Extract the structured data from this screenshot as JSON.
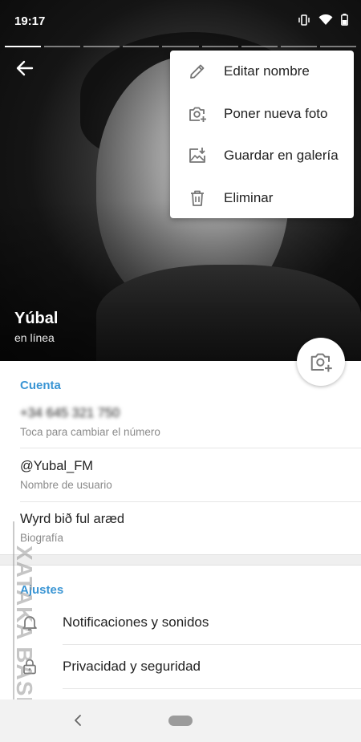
{
  "status_bar": {
    "time": "19:17"
  },
  "profile": {
    "name": "Yúbal",
    "status": "en línea"
  },
  "menu": {
    "items": [
      {
        "label": "Editar nombre",
        "icon": "pencil-icon"
      },
      {
        "label": "Poner nueva foto",
        "icon": "camera-add-icon"
      },
      {
        "label": "Guardar en galería",
        "icon": "save-image-icon"
      },
      {
        "label": "Eliminar",
        "icon": "trash-icon"
      }
    ]
  },
  "account": {
    "title": "Cuenta",
    "phone_value": "+34 645 321 750",
    "phone_hint": "Toca para cambiar el número",
    "username_value": "@Yubal_FM",
    "username_hint": "Nombre de usuario",
    "bio_value": "Wyrd bið ful aræd",
    "bio_hint": "Biografía"
  },
  "settings": {
    "title": "Ajustes",
    "items": [
      {
        "label": "Notificaciones y sonidos",
        "icon": "bell-icon"
      },
      {
        "label": "Privacidad y seguridad",
        "icon": "lock-icon"
      }
    ]
  },
  "watermark": {
    "text": "XATAKA BASICS"
  },
  "colors": {
    "accent": "#3a95d4",
    "menu_bg": "#ffffff",
    "text": "#222222",
    "hint": "#8a8a8a"
  }
}
